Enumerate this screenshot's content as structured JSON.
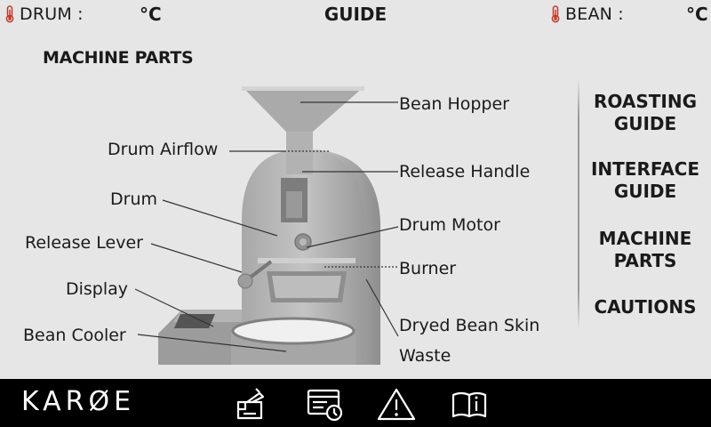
{
  "header": {
    "drum_label": "DRUM :",
    "drum_unit": "°C",
    "title": "GUIDE",
    "bean_label": "BEAN :",
    "bean_unit": "°C"
  },
  "section_title": "MACHINE PARTS",
  "parts": {
    "bean_hopper": "Bean Hopper",
    "drum_airflow": "Drum Airflow",
    "release_handle": "Release Handle",
    "drum": "Drum",
    "drum_motor": "Drum Motor",
    "release_lever": "Release Lever",
    "burner": "Burner",
    "display": "Display",
    "bean_cooler": "Bean Cooler",
    "dryed_bean_skin": "Dryed Bean Skin",
    "waste": "Waste"
  },
  "nav": {
    "roasting_guide": "ROASTING\nGUIDE",
    "interface_guide": "INTERFACE\nGUIDE",
    "machine_parts": "MACHINE\nPARTS",
    "cautions": "CAUTIONS"
  },
  "footer": {
    "brand": "KARØE",
    "icons": [
      "roast-profile-icon",
      "recipe-card-icon",
      "warning-icon",
      "guide-book-icon"
    ]
  },
  "colors": {
    "background": "#e6e6e6",
    "bottom_bar": "#000000",
    "thermometer": "#c0392b"
  }
}
